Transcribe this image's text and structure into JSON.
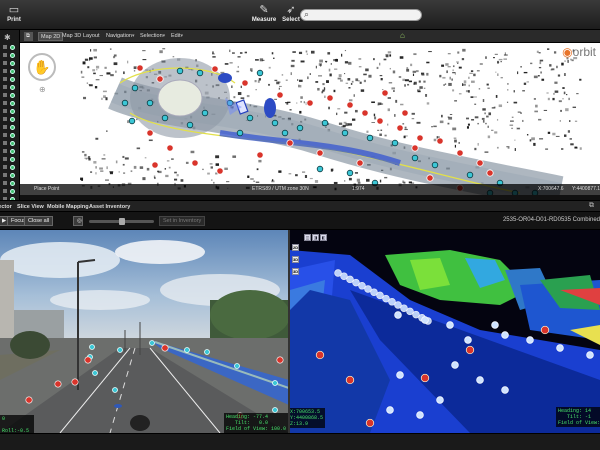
{
  "toolbar": {
    "print_label": "Print",
    "measure_label": "Measure",
    "select_label": "Select",
    "search": {
      "placeholder": ""
    }
  },
  "map_tabs": {
    "tab_2d": "Map 2D",
    "tab_3d": "Map 3D",
    "layout": "Layout",
    "navigation": "Navigation",
    "selection": "Selection",
    "edit": "Edit",
    "chevron": "▾"
  },
  "map": {
    "logo": "orbit",
    "status_left": "Place Point",
    "status_mid": "ETRS89 / UTM zone 30N",
    "status_scale": "1:974",
    "status_x": "X:700647.6",
    "status_y": "Y:4400877.1"
  },
  "lower_tabs": {
    "inspector": "Inspector",
    "slice_view": "Slice View",
    "mobile_mapping": "Mobile Mapping",
    "asset_inventory": "Asset Inventory"
  },
  "controls": {
    "btn_left": "▶",
    "btn_focus": "Focus",
    "btn_close_all": "Close all",
    "btn_record": "Set in Inventory",
    "dataset": "2535-OR04-D01-RD0535 Combined",
    "slider_level": 0.5
  },
  "view_tools": {
    "t1": "2D",
    "t2": "3D",
    "t3": "3D"
  },
  "hud": {
    "photo_left": "0\n\nRoll:-0.5\nPitch:-1.2",
    "photo_right": "Heading: -77.4\n   Tilt:   0.0\nField of View: 100.0",
    "photo_coords": "X:700653.5\nY:4400868.5\nZ:13.9",
    "cloud_right": "Heading: 14\n   Tilt: -1\nField of View:"
  },
  "colors": {
    "accent_green": "#47e06b",
    "point_red": "#d9342b",
    "point_cyan": "#3cc7d6",
    "orbit_orange": "#e8742a"
  }
}
